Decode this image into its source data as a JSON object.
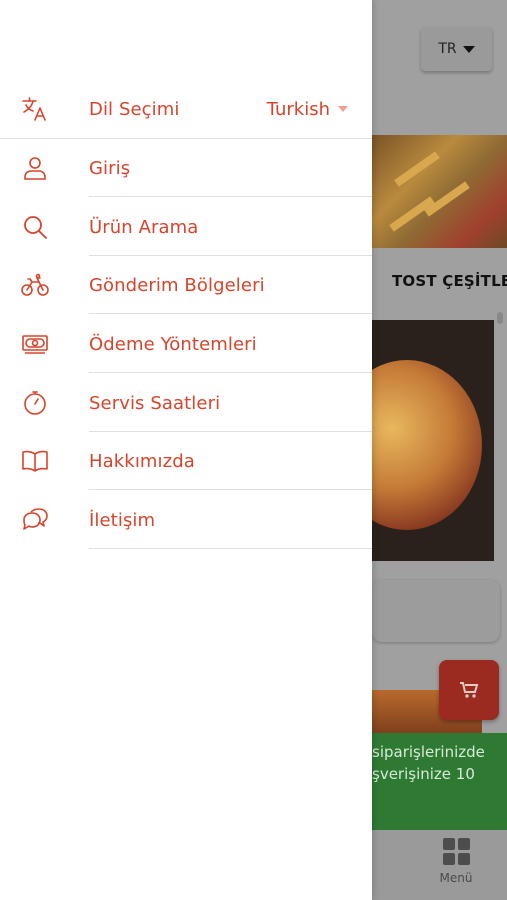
{
  "app": {
    "accent_color": "#d8442b",
    "background_dim_color": "#a0a0a0"
  },
  "header": {
    "language_button_label": "TR"
  },
  "drawer": {
    "language_row": {
      "label": "Dil Seçimi",
      "value": "Turkish",
      "icon": "translate-icon"
    },
    "items": [
      {
        "label": "Giriş",
        "icon": "user-icon"
      },
      {
        "label": "Ürün Arama",
        "icon": "search-icon"
      },
      {
        "label": "Gönderim Bölgeleri",
        "icon": "bicycle-icon"
      },
      {
        "label": "Ödeme Yöntemleri",
        "icon": "cash-icon"
      },
      {
        "label": "Servis Saatleri",
        "icon": "timer-icon"
      },
      {
        "label": "Hakkımızda",
        "icon": "book-icon"
      },
      {
        "label": "İletişim",
        "icon": "chat-icon"
      }
    ]
  },
  "main": {
    "category_label": "TOST ÇEŞİTLE",
    "promo_line1": "siparişlerinizde",
    "promo_line2": "şverişinize 10"
  },
  "bottom_nav": {
    "menu_label": "Menü"
  }
}
